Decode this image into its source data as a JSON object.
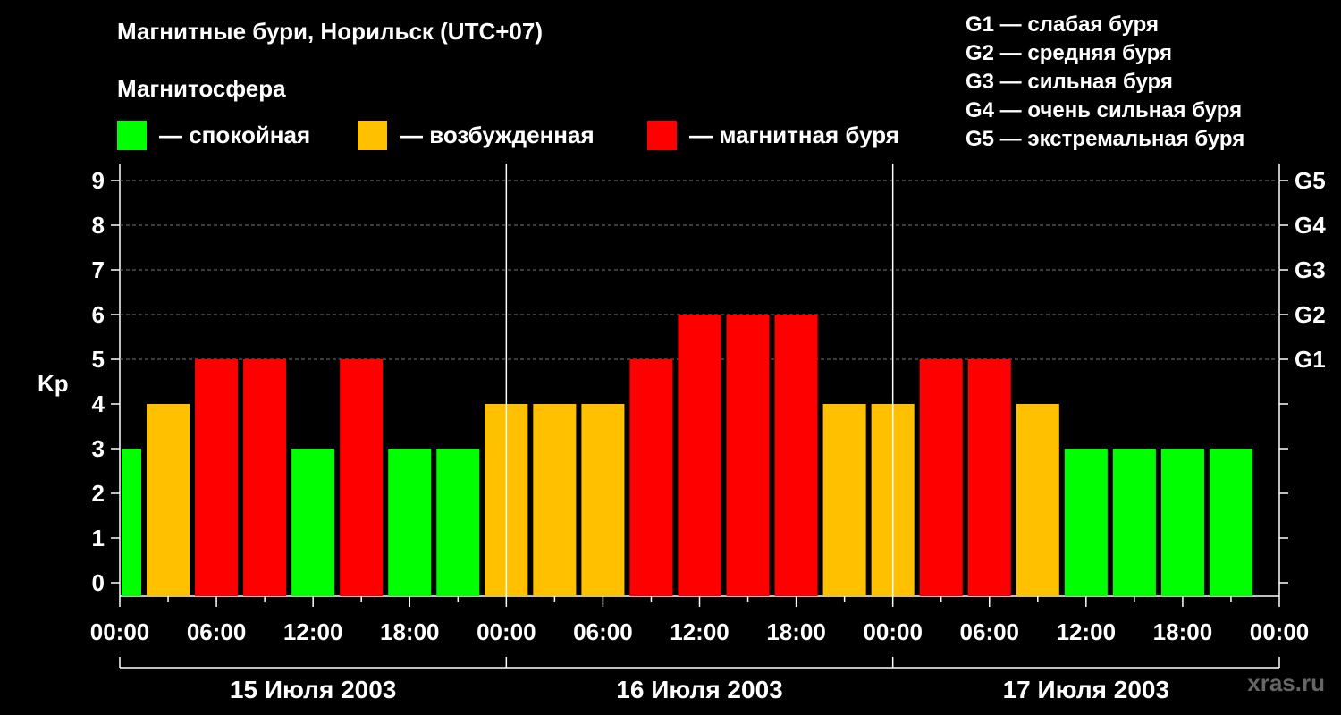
{
  "header": {
    "title": "Магнитные бури, Норильск (UTC+07)",
    "subtitle": "Магнитосфера"
  },
  "legend": [
    {
      "label": "— спокойная",
      "color": "#00ff00"
    },
    {
      "label": "— возбужденная",
      "color": "#ffc000"
    },
    {
      "label": "— магнитная буря",
      "color": "#ff0000"
    }
  ],
  "g_scale": [
    "G1 — слабая буря",
    "G2 — средняя буря",
    "G3 — сильная буря",
    "G4 — очень сильная буря",
    "G5 — экстремальная буря"
  ],
  "watermark": "xras.ru",
  "chart_data": {
    "type": "bar",
    "title": "Магнитные бури, Норильск (UTC+07)",
    "ylabel": "Kp",
    "ylim": [
      0,
      9
    ],
    "yticks": [
      "0",
      "1",
      "2",
      "3",
      "4",
      "5",
      "6",
      "7",
      "8",
      "9"
    ],
    "grid": true,
    "right_axis": [
      {
        "kp": 5,
        "label": "G1"
      },
      {
        "kp": 6,
        "label": "G2"
      },
      {
        "kp": 7,
        "label": "G3"
      },
      {
        "kp": 8,
        "label": "G4"
      },
      {
        "kp": 9,
        "label": "G5"
      }
    ],
    "xticks": [
      "00:00",
      "06:00",
      "12:00",
      "18:00",
      "00:00",
      "06:00",
      "12:00",
      "18:00",
      "00:00",
      "06:00",
      "12:00",
      "18:00",
      "00:00"
    ],
    "days": [
      "15 Июля 2003",
      "16 Июля 2003",
      "17 Июля 2003"
    ],
    "interval_hours": 3,
    "categories": [
      "00:00",
      "03:00",
      "06:00",
      "09:00",
      "12:00",
      "15:00",
      "18:00",
      "21:00"
    ],
    "values": [
      3,
      4,
      5,
      5,
      3,
      5,
      3,
      3,
      4,
      4,
      4,
      5,
      6,
      6,
      6,
      4,
      4,
      5,
      5,
      4,
      3,
      3,
      3,
      3
    ],
    "colors": {
      "quiet": "#00ff00",
      "unsettled": "#ffc000",
      "storm": "#ff0000"
    }
  }
}
